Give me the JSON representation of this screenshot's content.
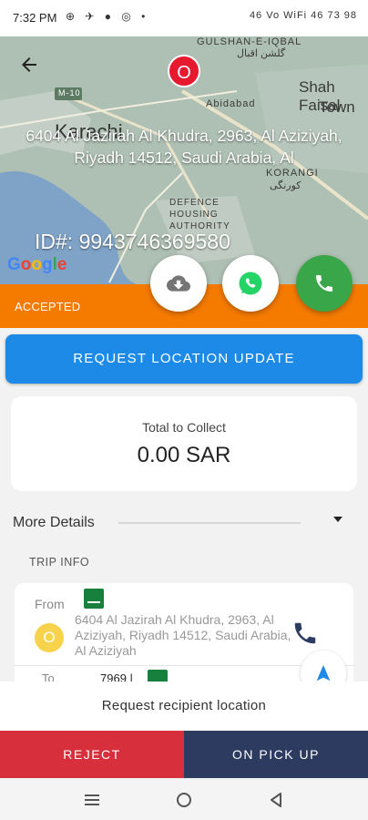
{
  "status_bar": {
    "time": "7:32 PM",
    "left_icons": "⊕ ✈ ● ◎ •",
    "right_text": "46 Vo WiFi 46 73 98"
  },
  "map": {
    "labels": {
      "gulshan": "GULSHAN-E-IQBAL",
      "gulshan_urdu": "گلشن اقبال",
      "abidabad": "Abidabad",
      "shah_faisal": "Shah Faisal",
      "town": "Town",
      "karachi": "Karachi",
      "korangi": "KORANGI",
      "korangi_urdu": "کورنگی",
      "defence": "DEFENCE HOUSING AUTHORITY",
      "m10": "M-10"
    },
    "marker_letter": "O",
    "google_letters": [
      "G",
      "o",
      "o",
      "g",
      "l",
      "e"
    ],
    "colors": {
      "land": "#9fb6a8",
      "water": "#7fa3c7"
    }
  },
  "order": {
    "address": "6404 Al Jazirah Al Khudra, 2963, Al Aziziyah, Riyadh 14512, Saudi Arabia, Al",
    "id_text": "ID#: 9943746369580",
    "status": "ACCEPTED"
  },
  "actions": {
    "request_location_update": "REQUEST LOCATION UPDATE",
    "request_recipient_location": "Request recipient location",
    "reject": "REJECT",
    "on_pick_up": "ON PICK UP"
  },
  "collect": {
    "label": "Total to Collect",
    "value": "0.00 SAR"
  },
  "details": {
    "more_details": "More Details",
    "trip_info": "TRIP INFO",
    "from_label": "From",
    "from_letter": "O",
    "from_address": "6404 Al Jazirah Al Khudra, 2963, Al Aziziyah, Riyadh 14512, Saudi Arabia, Al Aziziyah",
    "to_label": "To",
    "to_value": "7969 |"
  },
  "icons": {
    "back": "arrow-left-icon",
    "cloud": "cloud-download-icon",
    "whatsapp": "whatsapp-icon",
    "call": "phone-icon",
    "caret": "caret-down-icon",
    "navigate": "navigation-arrow-icon",
    "nav_menu": "menu-icon",
    "nav_home": "home-circle-icon",
    "nav_back": "back-triangle-icon"
  },
  "theme": {
    "accent": "#f47a00",
    "primary": "#1d8ae8",
    "reject": "#d82f3c",
    "pickup": "#2d3b61",
    "call": "#3aa64a",
    "marker": "#e6192e",
    "flag": "#16803c"
  }
}
